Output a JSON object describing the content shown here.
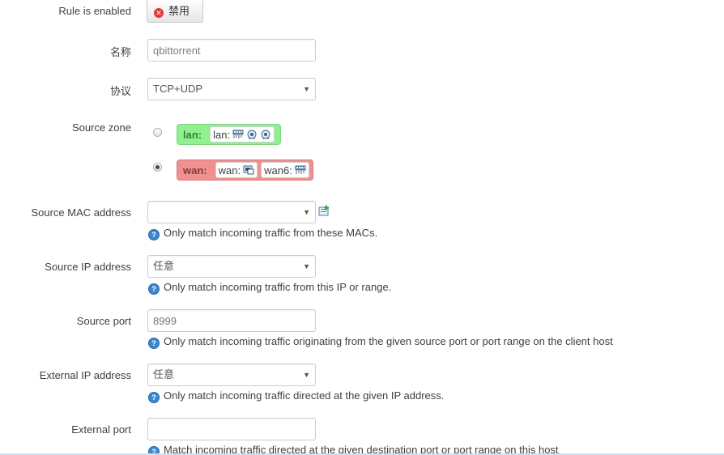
{
  "rule_enabled": {
    "label": "Rule is enabled",
    "button_label": "禁用"
  },
  "name": {
    "label": "名称",
    "value": "qbittorrent"
  },
  "protocol": {
    "label": "协议",
    "selected": "TCP+UDP"
  },
  "source_zone": {
    "label": "Source zone",
    "zones": [
      {
        "name": "lan:",
        "checked": false,
        "networks": [
          "lan:"
        ],
        "color": "#90f090"
      },
      {
        "name": "wan:",
        "checked": true,
        "networks": [
          "wan:",
          "wan6:"
        ],
        "color": "#f09090"
      }
    ]
  },
  "source_mac": {
    "label": "Source MAC address",
    "selected": "",
    "help": "Only match incoming traffic from these MACs."
  },
  "source_ip": {
    "label": "Source IP address",
    "selected": "任意",
    "help": "Only match incoming traffic from this IP or range."
  },
  "source_port": {
    "label": "Source port",
    "placeholder": "8999",
    "help": "Only match incoming traffic originating from the given source port or port range on the client host"
  },
  "external_ip": {
    "label": "External IP address",
    "selected": "任意",
    "help": "Only match incoming traffic directed at the given IP address."
  },
  "external_port": {
    "label": "External port",
    "value": "",
    "help": "Match incoming traffic directed at the given destination port or port range on this host"
  },
  "icons": {
    "disable": "close-circle-icon",
    "help": "help-icon",
    "add": "add-mac-icon",
    "network": "network-port-icon",
    "wifi": "wifi-icon"
  }
}
